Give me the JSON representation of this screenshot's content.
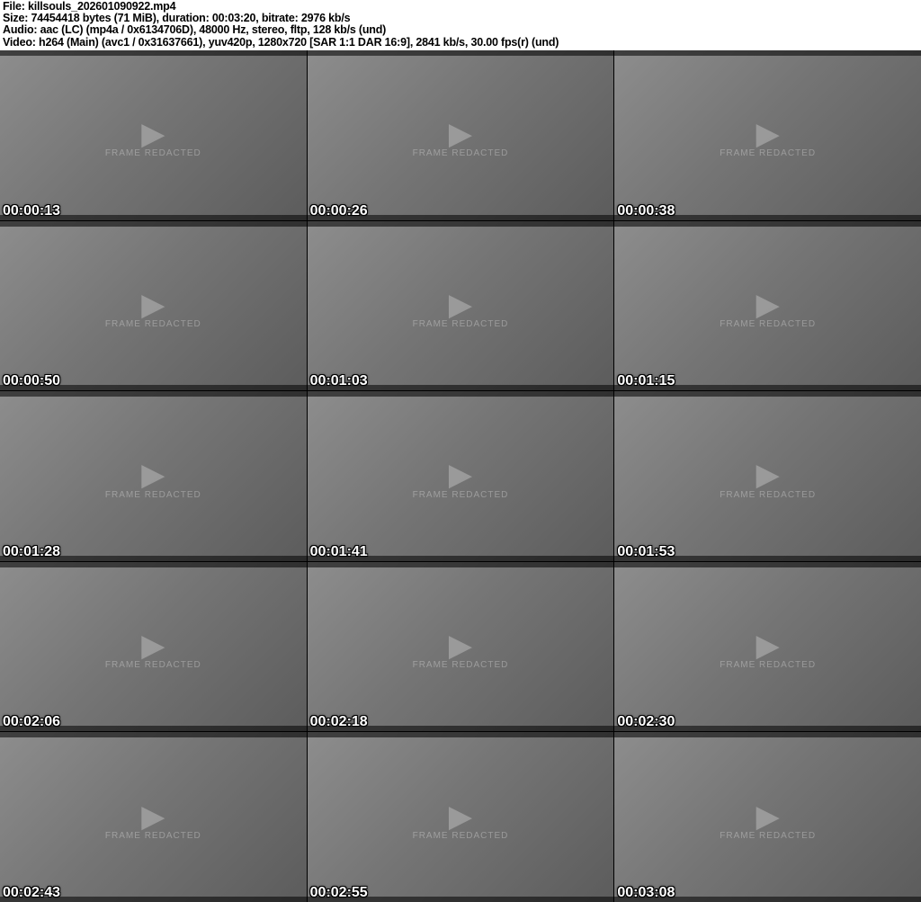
{
  "header": {
    "lines": [
      "File: killsouls_202601090922.mp4",
      "Size: 74454418 bytes (71 MiB), duration: 00:03:20, bitrate: 2976 kb/s",
      "Audio: aac (LC) (mp4a / 0x6134706D), 48000 Hz, stereo, fltp, 128 kb/s (und)",
      "Video: h264 (Main) (avc1 / 0x31637661), yuv420p, 1280x720 [SAR 1:1 DAR 16:9], 2841 kb/s, 30.00 fps(r) (und)"
    ]
  },
  "grid": {
    "columns": 3,
    "rows": 5,
    "placeholder_icon": "▶",
    "placeholder_label": "frame redacted"
  },
  "thumbnails": [
    {
      "timestamp": "00:00:13"
    },
    {
      "timestamp": "00:00:26"
    },
    {
      "timestamp": "00:00:38"
    },
    {
      "timestamp": "00:00:50"
    },
    {
      "timestamp": "00:01:03"
    },
    {
      "timestamp": "00:01:15"
    },
    {
      "timestamp": "00:01:28"
    },
    {
      "timestamp": "00:01:41"
    },
    {
      "timestamp": "00:01:53"
    },
    {
      "timestamp": "00:02:06"
    },
    {
      "timestamp": "00:02:18"
    },
    {
      "timestamp": "00:02:30"
    },
    {
      "timestamp": "00:02:43"
    },
    {
      "timestamp": "00:02:55"
    },
    {
      "timestamp": "00:03:08"
    }
  ],
  "colors": {
    "header_bg": "#ffffff",
    "header_text": "#000000",
    "grid_bg": "#000000",
    "timestamp_text": "#ffffff"
  }
}
